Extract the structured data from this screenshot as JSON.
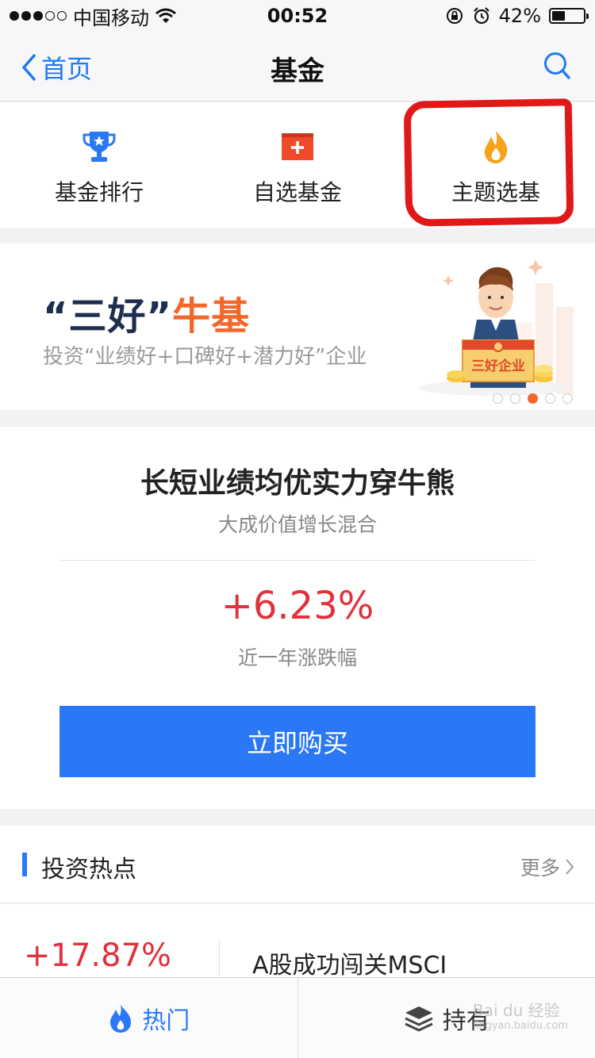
{
  "status_bar": {
    "carrier": "中国移动",
    "time": "00:52",
    "battery": "42%",
    "battery_level": 0.42
  },
  "nav": {
    "back_label": "首页",
    "title": "基金",
    "search_icon": "search-icon"
  },
  "quick_entries": [
    {
      "label": "基金排行",
      "icon": "trophy-icon",
      "color": "#2a78f6"
    },
    {
      "label": "自选基金",
      "icon": "plus-box-icon",
      "color": "#f04a2a"
    },
    {
      "label": "主题选基",
      "icon": "flame-icon",
      "color": "#f7a21b"
    }
  ],
  "banner": {
    "title_main": "“三好”",
    "title_accent": "牛基",
    "subtitle": "投资“业绩好+口碑好+潜力好”企业",
    "certificate_text": "三好企业",
    "pages": 5,
    "active_page": 3
  },
  "fund_card": {
    "slogan": "长短业绩均优实力穿牛熊",
    "fund_name": "大成价值增长混合",
    "rate": "+6.23%",
    "rate_label": "近一年涨跌幅",
    "buy_label": "立即购买"
  },
  "hot": {
    "title": "投资热点",
    "more": "更多",
    "items": [
      {
        "rate": "+17.87%",
        "name": "A股成功闯关MSCI"
      }
    ]
  },
  "tabbar": {
    "tabs": [
      {
        "label": "热门",
        "icon": "flame-icon",
        "active": true
      },
      {
        "label": "持有",
        "icon": "layers-icon",
        "active": false
      }
    ]
  },
  "watermark": {
    "text": "Bai du 经验",
    "sub": "jingyan.baidu.com"
  },
  "colors": {
    "accent_blue": "#2a78f6",
    "rise_red": "#e0323c",
    "banner_orange": "#f2672a",
    "annotation_red": "#e01818"
  }
}
